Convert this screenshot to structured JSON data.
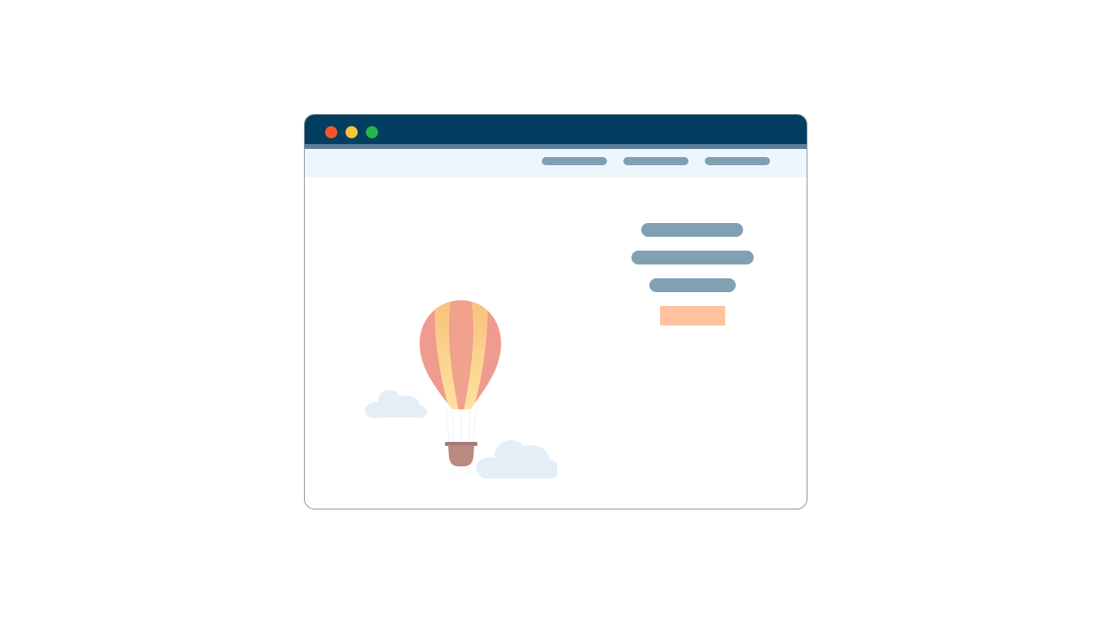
{
  "window": {
    "traffic_lights": [
      {
        "name": "close",
        "color": "#f6562b"
      },
      {
        "name": "minimize",
        "color": "#f8c43c"
      },
      {
        "name": "maximize",
        "color": "#28b44a"
      }
    ],
    "titlebar_color": "#023e5f",
    "navbar_color": "#edf6fd"
  },
  "navbar": {
    "items": [
      {
        "label": ""
      },
      {
        "label": ""
      },
      {
        "label": ""
      }
    ],
    "item_color": "#7f9fb3"
  },
  "hero": {
    "lines": [
      {
        "text": ""
      },
      {
        "text": ""
      },
      {
        "text": ""
      }
    ],
    "line_color": "#80a0b4",
    "button": {
      "label": "",
      "color": "#ffc39f"
    }
  },
  "illustration": {
    "balloon_icon": "hot-air-balloon-icon",
    "cloud_icon": "cloud-icon",
    "balloon_colors": [
      "#f09b8f",
      "#f9c48a",
      "#fde19c"
    ],
    "basket_color": "#b98a80",
    "cloud_color": "#e5edf7"
  }
}
